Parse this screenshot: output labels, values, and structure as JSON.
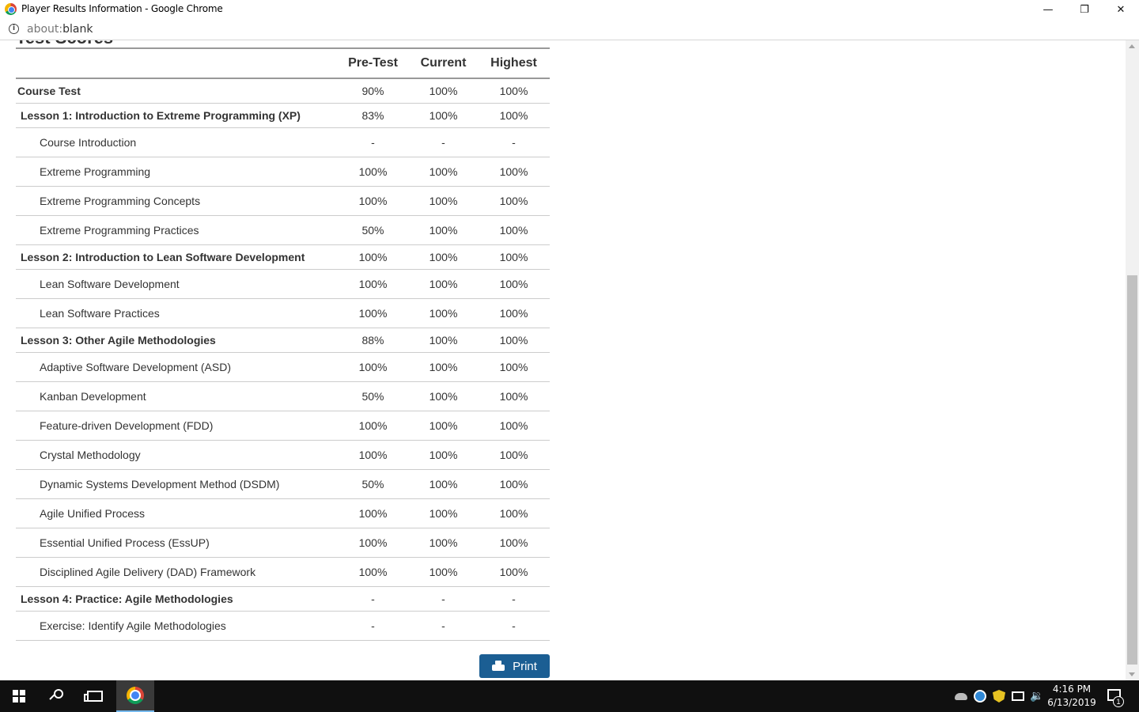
{
  "window": {
    "title": "Player Results Information - Google Chrome",
    "minimize_glyph": "—",
    "maximize_glyph": "❐",
    "close_glyph": "✕"
  },
  "address": {
    "info_glyph": "i",
    "scheme": "about:",
    "path": "blank"
  },
  "page": {
    "heading_partial": "Test Scores",
    "columns": [
      "",
      "Pre-Test",
      "Current",
      "Highest"
    ],
    "rows": [
      {
        "kind": "course",
        "name": "Course Test",
        "pre": "90%",
        "current": "100%",
        "highest": "100%"
      },
      {
        "kind": "lesson",
        "name": "Lesson 1: Introduction to Extreme Programming (XP)",
        "pre": "83%",
        "current": "100%",
        "highest": "100%"
      },
      {
        "kind": "topic",
        "name": "Course Introduction",
        "pre": "-",
        "current": "-",
        "highest": "-"
      },
      {
        "kind": "topic",
        "name": "Extreme Programming",
        "pre": "100%",
        "current": "100%",
        "highest": "100%"
      },
      {
        "kind": "topic",
        "name": "Extreme Programming Concepts",
        "pre": "100%",
        "current": "100%",
        "highest": "100%"
      },
      {
        "kind": "topic",
        "name": "Extreme Programming Practices",
        "pre": "50%",
        "current": "100%",
        "highest": "100%"
      },
      {
        "kind": "lesson",
        "name": "Lesson 2: Introduction to Lean Software Development",
        "pre": "100%",
        "current": "100%",
        "highest": "100%"
      },
      {
        "kind": "topic",
        "name": "Lean Software Development",
        "pre": "100%",
        "current": "100%",
        "highest": "100%"
      },
      {
        "kind": "topic",
        "name": "Lean Software Practices",
        "pre": "100%",
        "current": "100%",
        "highest": "100%"
      },
      {
        "kind": "lesson",
        "name": "Lesson 3: Other Agile Methodologies",
        "pre": "88%",
        "current": "100%",
        "highest": "100%"
      },
      {
        "kind": "topic",
        "name": "Adaptive Software Development (ASD)",
        "pre": "100%",
        "current": "100%",
        "highest": "100%"
      },
      {
        "kind": "topic",
        "name": "Kanban Development",
        "pre": "50%",
        "current": "100%",
        "highest": "100%"
      },
      {
        "kind": "topic",
        "name": "Feature-driven Development (FDD)",
        "pre": "100%",
        "current": "100%",
        "highest": "100%"
      },
      {
        "kind": "topic",
        "name": "Crystal Methodology",
        "pre": "100%",
        "current": "100%",
        "highest": "100%"
      },
      {
        "kind": "topic",
        "name": "Dynamic Systems Development Method (DSDM)",
        "pre": "50%",
        "current": "100%",
        "highest": "100%"
      },
      {
        "kind": "topic",
        "name": "Agile Unified Process",
        "pre": "100%",
        "current": "100%",
        "highest": "100%"
      },
      {
        "kind": "topic",
        "name": "Essential Unified Process (EssUP)",
        "pre": "100%",
        "current": "100%",
        "highest": "100%"
      },
      {
        "kind": "topic",
        "name": "Disciplined Agile Delivery (DAD) Framework",
        "pre": "100%",
        "current": "100%",
        "highest": "100%"
      },
      {
        "kind": "lesson",
        "name": "Lesson 4: Practice: Agile Methodologies",
        "pre": "-",
        "current": "-",
        "highest": "-"
      },
      {
        "kind": "topic",
        "name": "Exercise: Identify Agile Methodologies",
        "pre": "-",
        "current": "-",
        "highest": "-"
      }
    ],
    "print_label": "Print",
    "print_color": "#1b5e93"
  },
  "taskbar": {
    "time": "4:16 PM",
    "date": "6/13/2019",
    "volume_glyph": "🔉",
    "notification_count": "1"
  }
}
